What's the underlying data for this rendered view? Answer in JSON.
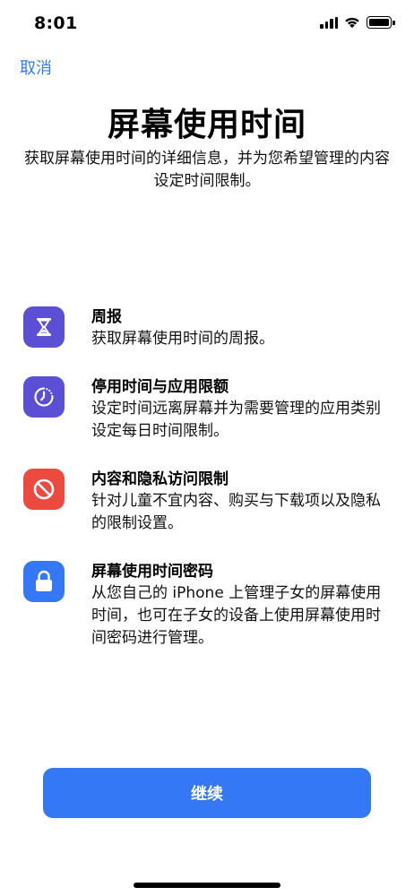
{
  "status_bar": {
    "time": "8:01"
  },
  "nav": {
    "cancel_label": "取消"
  },
  "header": {
    "title": "屏幕使用时间",
    "subtitle": "获取屏幕使用时间的详细信息，并为您希望管理的内容设定时间限制。"
  },
  "features": [
    {
      "title": "周报",
      "desc": "获取屏幕使用时间的周报。",
      "icon": "hourglass-icon",
      "color": "#5b4fd6"
    },
    {
      "title": "停用时间与应用限额",
      "desc": "设定时间远离屏幕并为需要管理的应用类别设定每日时间限制。",
      "icon": "downtime-icon",
      "color": "#5b4fd6"
    },
    {
      "title": "内容和隐私访问限制",
      "desc": "针对儿童不宜内容、购买与下载项以及隐私的限制设置。",
      "icon": "no-entry-icon",
      "color": "#ec4a3e"
    },
    {
      "title": "屏幕使用时间密码",
      "desc": "从您自己的 iPhone 上管理子女的屏幕使用时间，也可在子女的设备上使用屏幕使用时间密码进行管理。",
      "icon": "lock-icon",
      "color": "#3478f6"
    }
  ],
  "footer": {
    "continue_label": "继续"
  }
}
